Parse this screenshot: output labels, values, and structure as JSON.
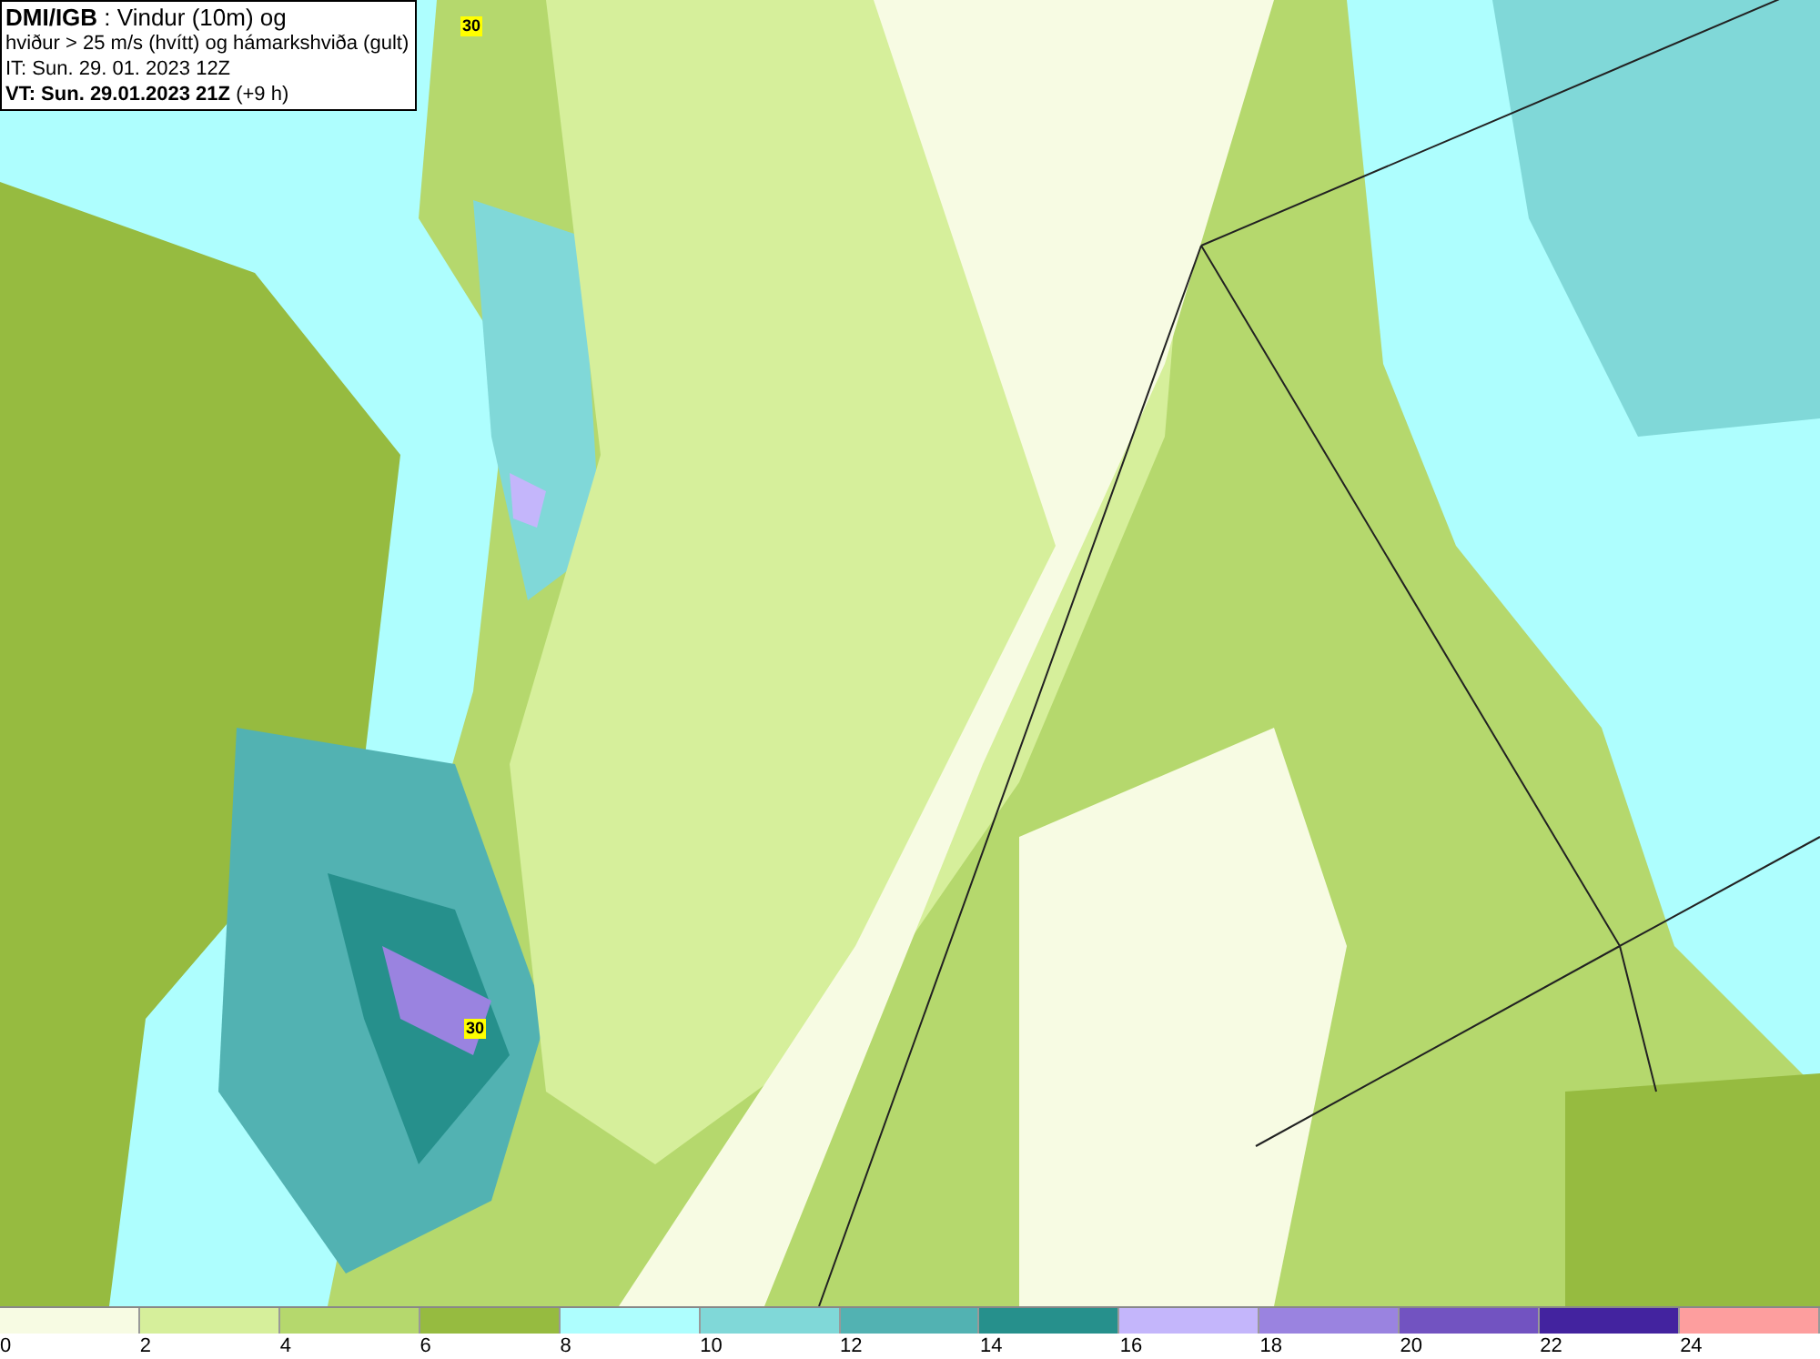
{
  "header": {
    "lines": [
      "**DMI/IGB** : Vindur (10m) og",
      "hviður > 25 m/s (hvítt) og hámarkshviða (gult)",
      "IT: Sun. 29. 01. 2023 12Z",
      "**VT: Sun. 29.01.2023 21Z** (+9 h)"
    ]
  },
  "map": {
    "gust_labels": [
      "30",
      "30"
    ]
  },
  "legend": [
    {
      "label": "0",
      "color": "#f7fbe3"
    },
    {
      "label": "2",
      "color": "#d6ef9b"
    },
    {
      "label": "4",
      "color": "#b5d86d"
    },
    {
      "label": "6",
      "color": "#96bb40"
    },
    {
      "label": "8",
      "color": "#aefefe"
    },
    {
      "label": "10",
      "color": "#80d8d8"
    },
    {
      "label": "12",
      "color": "#52b2b2"
    },
    {
      "label": "14",
      "color": "#26908c"
    },
    {
      "label": "16",
      "color": "#c4b6fb"
    },
    {
      "label": "18",
      "color": "#9a83e0"
    },
    {
      "label": "20",
      "color": "#7253c1"
    },
    {
      "label": "22",
      "color": "#43239f"
    },
    {
      "label": "24",
      "color": "#fd9e9e"
    }
  ]
}
